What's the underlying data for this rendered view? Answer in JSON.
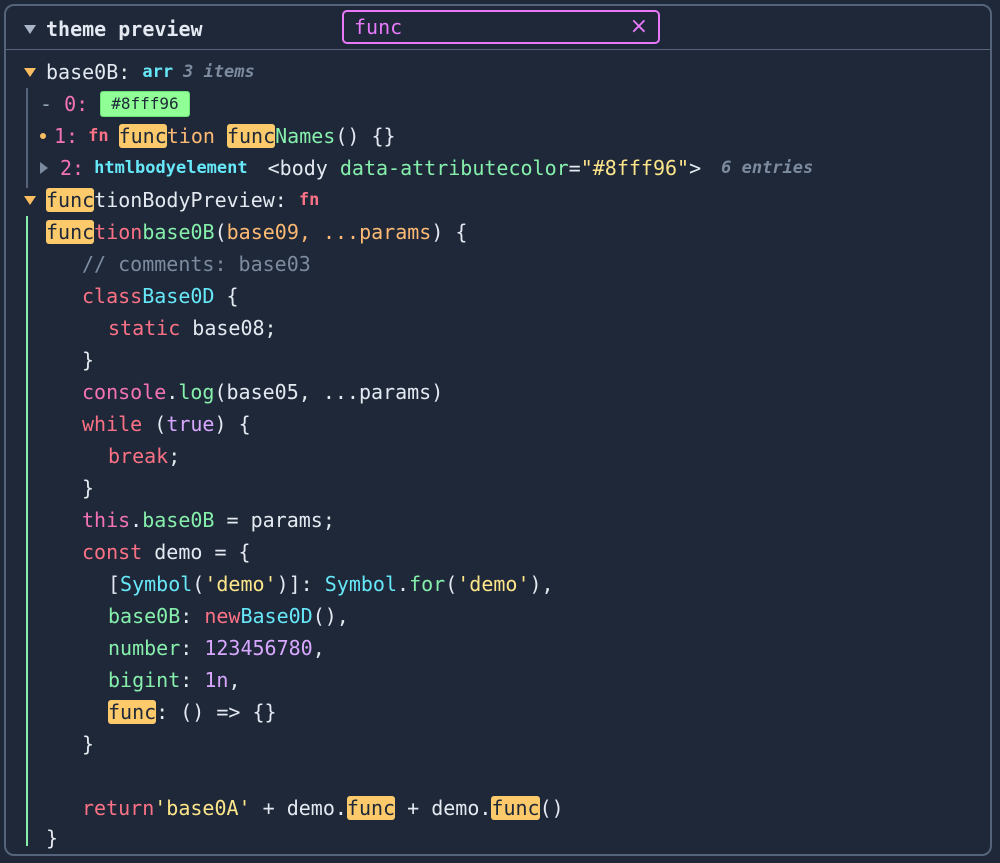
{
  "header": {
    "title": "theme preview",
    "search_value": "func",
    "clear_icon": "×"
  },
  "tree": {
    "root_key": "base0B",
    "root_sep": ": ",
    "root_type": "arr",
    "root_meta": "3 items",
    "item0": {
      "prefix": "- ",
      "index": "0:",
      "swatch": "#8fff96"
    },
    "item1": {
      "index": "1:",
      "type": "fn",
      "hl_a": "func",
      "rest_a": "tion ",
      "hl_b": "func",
      "rest_b": "Names",
      "tail": "() {}"
    },
    "item2": {
      "index": "2:",
      "type": "htmlbodyelement",
      "tag_open": "<body ",
      "attr": "data-attributecolor",
      "eq": "=",
      "attr_val": "\"#8fff96\"",
      "tag_close": ">",
      "meta": "6 entries"
    },
    "fb_key_hl": "func",
    "fb_key_rest": "tionBodyPreview",
    "fb_sep": ": ",
    "fb_type": "fn"
  },
  "code": {
    "l1": {
      "kw_hl": "func",
      "kw_rest": "tion",
      "name": "base0B",
      "p_open": "(",
      "params": "base09, ...params",
      "p_close": ") {"
    },
    "l2": "// comments: base03",
    "l3": {
      "kw": "class",
      "name": "Base0D",
      "brace": " {"
    },
    "l4": {
      "kw": "static",
      "name": " base08;"
    },
    "l5": "}",
    "l6": {
      "obj": "console",
      "dot": ".",
      "fn": "log",
      "args": "(base05, ...params)"
    },
    "l7": {
      "kw": "while",
      "open": " (",
      "val": "true",
      "close": ") {"
    },
    "l8": {
      "kw": "break",
      "semi": ";"
    },
    "l9": "}",
    "l10": {
      "kw": "this",
      "dot": ".",
      "prop": "base0B",
      "rest": " = params;"
    },
    "l11": {
      "kw": "const",
      "rest": " demo = {"
    },
    "l12": {
      "open": "[",
      "sym": "Symbol",
      "p1": "(",
      "str1": "'demo'",
      "p2": ")]: ",
      "sym2": "Symbol",
      "dot": ".",
      "fn": "for",
      "p3": "(",
      "str2": "'demo'",
      "p4": "),"
    },
    "l13": {
      "key": "base0B",
      "colon": ": ",
      "kw": "new",
      "cls": "Base0D",
      "tail": "(),"
    },
    "l14": {
      "key": "number",
      "colon": ": ",
      "num": "123456780",
      "comma": ","
    },
    "l15": {
      "key": "bigint",
      "colon": ": ",
      "num": "1n",
      "comma": ","
    },
    "l16": {
      "key_hl": "func",
      "rest": ": () => {}"
    },
    "l17": "}",
    "l18": {
      "kw": "return",
      "str": "'base0A'",
      "plus1": " + demo.",
      "hl1": "func",
      "plus2": " + demo.",
      "hl2": "func",
      "tail": "()"
    },
    "l19": "}"
  }
}
